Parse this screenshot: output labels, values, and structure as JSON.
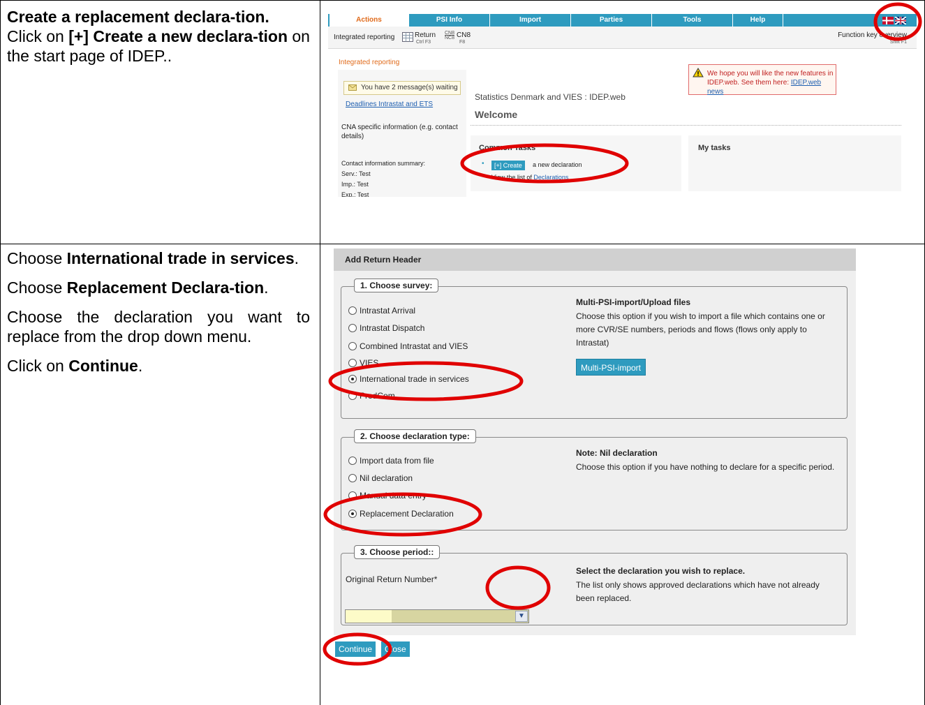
{
  "row1": {
    "instruction_title": "Create a replacement declara-tion.",
    "instruction_line1_pre": "Click on ",
    "instruction_line1_bold": "[+] Create a new declara-tion",
    "instruction_line1_post": " on the start page of IDEP.."
  },
  "row2": {
    "p1_pre": "Choose ",
    "p1_bold": "International trade in services",
    "p1_post": ".",
    "p2_pre": "Choose ",
    "p2_bold": "Replacement Declara-tion",
    "p2_post": ".",
    "p3": "Choose the declaration you want to replace from the drop down menu.",
    "p4_pre": "Click on ",
    "p4_bold": "Continue",
    "p4_post": "."
  },
  "idep_start": {
    "menu": [
      "Actions",
      "PSI Info",
      "Import",
      "Parties",
      "Tools",
      "Help"
    ],
    "toolbar": {
      "integrated": "Integrated reporting",
      "return_label": "Return",
      "return_sub": "Ctrl F3",
      "cn8_icon_top": "CN8",
      "cn8_icon_bottom": "NC8",
      "cn8_label": "CN8",
      "cn8_sub": "F8",
      "function_key": "Function key overview",
      "function_sub": "Shift F1"
    },
    "breadcrumb": "Integrated reporting",
    "messages": "You have 2 message(s) waiting",
    "deadlines": "Deadlines Intrastat and ETS",
    "cna": "CNA specific information (e.g. contact details)",
    "contact_title": "Contact information summary:",
    "contact_lines": [
      "Serv.: Test",
      "Imp.: Test",
      "Exp.: Test"
    ],
    "notice_text": "We hope you will like the new features in IDEP.web. See them here: ",
    "notice_link": "IDEP.web news",
    "stat_title": "Statistics Denmark and VIES : IDEP.web",
    "welcome": "Welcome",
    "common_tasks": "Common Tasks",
    "create_btn": "[+] Create",
    "create_after": "a new declaration",
    "view_pre": "View the list of ",
    "view_link": "Declarations",
    "my_tasks": "My tasks"
  },
  "return_header": {
    "title": "Add Return Header",
    "survey_legend": "1. Choose survey:",
    "survey_options": [
      {
        "label": "Intrastat Arrival",
        "selected": false
      },
      {
        "label": "Intrastat Dispatch",
        "selected": false
      },
      {
        "label": "Combined Intrastat and VIES",
        "selected": false
      },
      {
        "label": "VIES",
        "selected": false
      },
      {
        "label": "International trade in services",
        "selected": true
      },
      {
        "label": "ProdCom",
        "selected": false
      }
    ],
    "multi_title": "Multi-PSI-import/Upload files",
    "multi_text": "Choose this option if you wish to import a file which contains one or more CVR/SE numbers, periods and flows (flows only apply to Intrastat)",
    "multi_button": "Multi-PSI-import",
    "type_legend": "2. Choose declaration type:",
    "type_options": [
      {
        "label": "Import data from file",
        "selected": false
      },
      {
        "label": "Nil declaration",
        "selected": false
      },
      {
        "label": "Manual data entry",
        "selected": false
      },
      {
        "label": "Replacement Declaration",
        "selected": true
      }
    ],
    "nil_title": "Note: Nil declaration",
    "nil_text": "Choose this option if you have nothing to declare for a specific period.",
    "period_legend": "3. Choose period::",
    "original_label": "Original Return Number*",
    "original_value": "",
    "replace_title": "Select the declaration you wish to replace.",
    "replace_text": "The list only shows approved declarations which have not already been replaced.",
    "continue": "Continue",
    "close": "Close"
  },
  "colors": {
    "accent_blue": "#2e9bbf",
    "annotation_red": "#e00000",
    "breadcrumb_orange": "#e06a1a"
  }
}
